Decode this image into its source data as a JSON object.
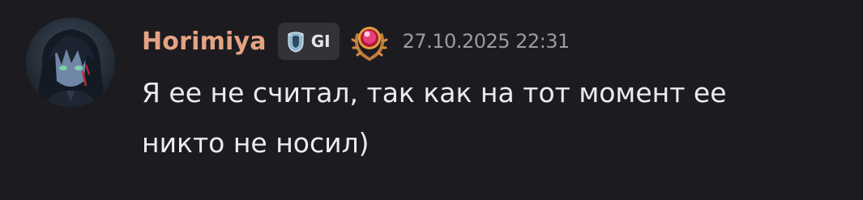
{
  "message": {
    "author": {
      "username": "Horimiya",
      "username_color": "#e6a383"
    },
    "tag": {
      "icon": "crystal-shield-icon",
      "label": "GI"
    },
    "badge": {
      "icon": "pink-orb-laurel-badge-icon"
    },
    "timestamp": "27.10.2025 22:31",
    "content_lines": [
      "Я ее не считал, так как на тот момент ее",
      "никто не носил)"
    ]
  }
}
